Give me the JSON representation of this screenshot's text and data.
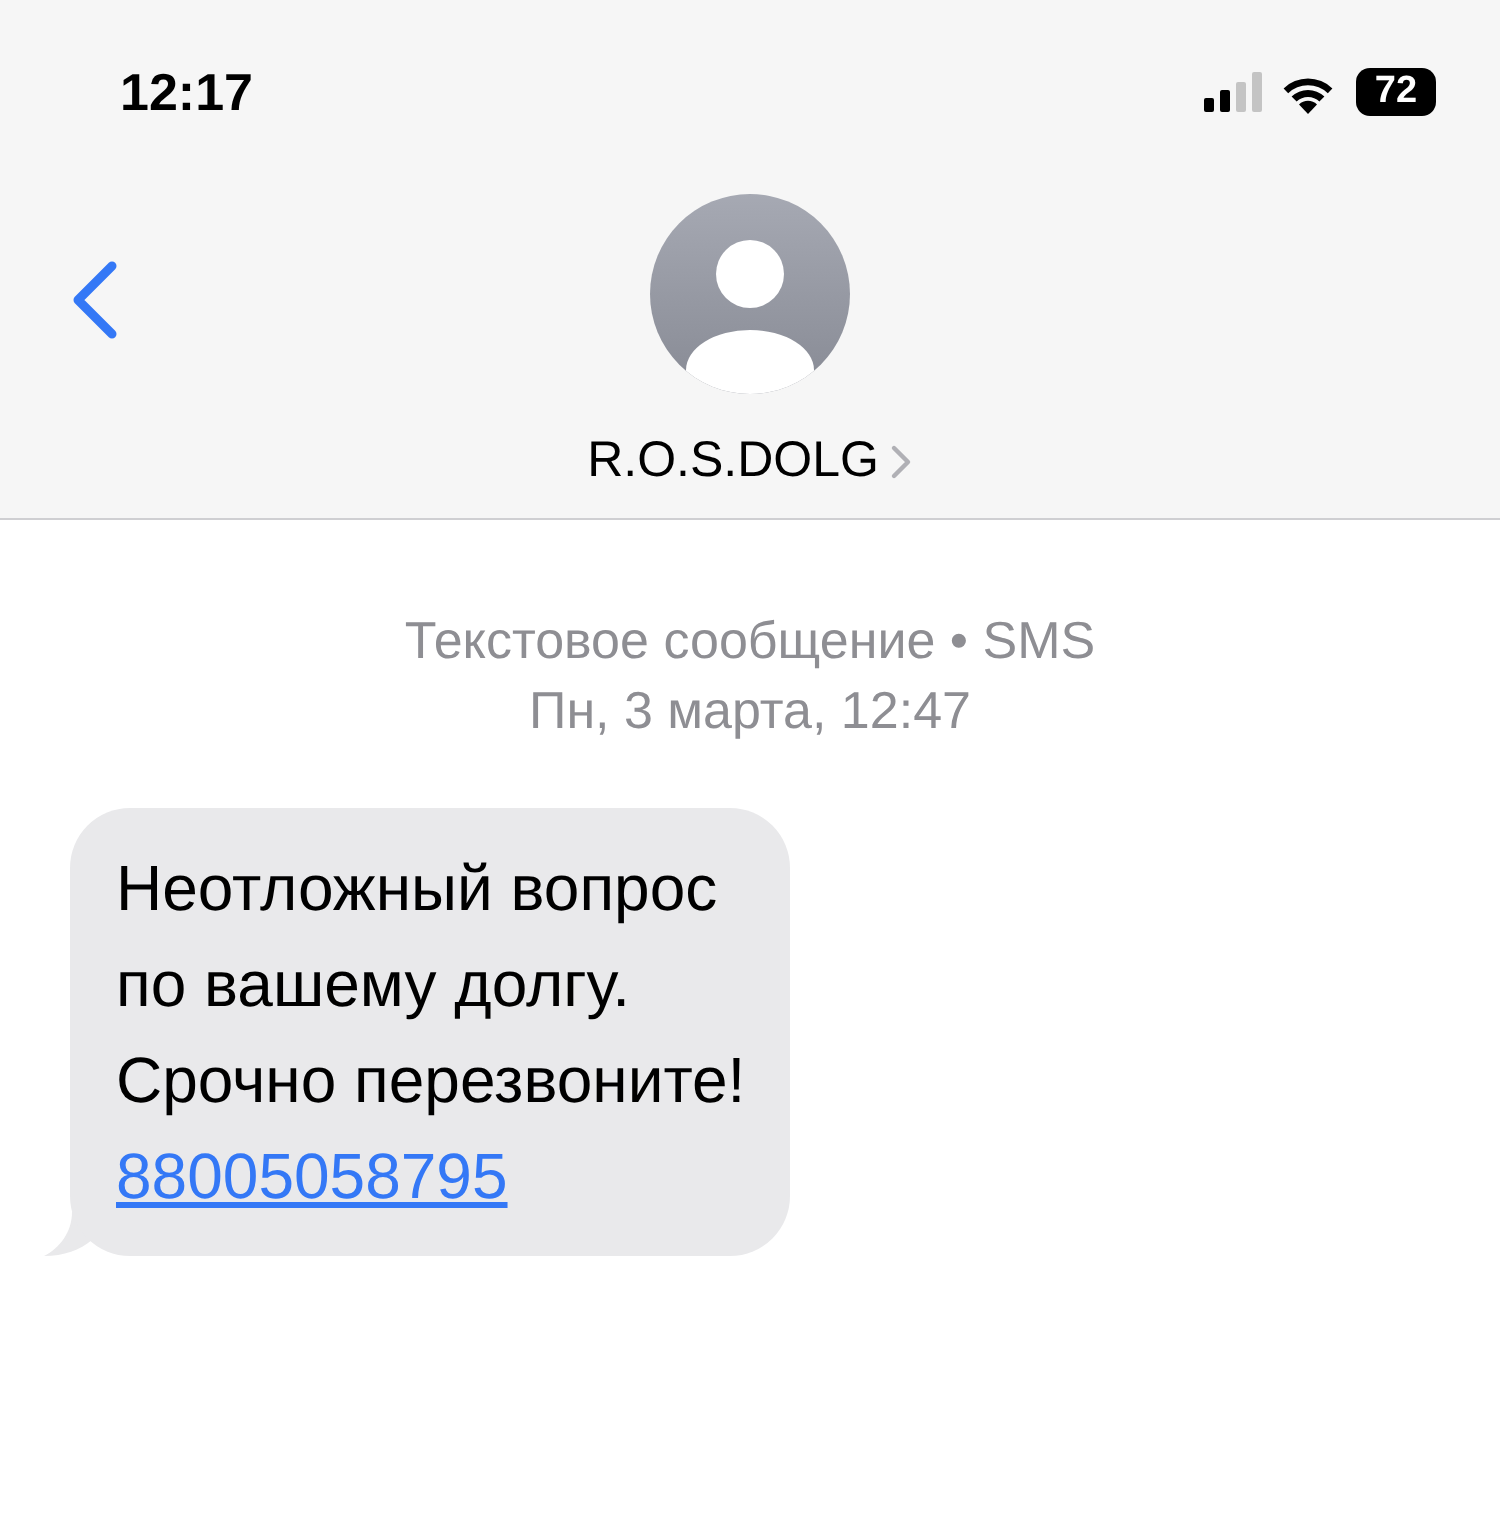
{
  "status_bar": {
    "time": "12:17",
    "battery": "72"
  },
  "header": {
    "contact_name": "R.O.S.DOLG"
  },
  "message_meta": {
    "service": "Текстовое сообщение • SMS",
    "date": "Пн, 3 марта, 12:47"
  },
  "messages": [
    {
      "kind": "incoming",
      "text": "Неотложный вопрос\nпо вашему долгу.\nСрочно перезвоните!",
      "link": "88005058795"
    }
  ]
}
